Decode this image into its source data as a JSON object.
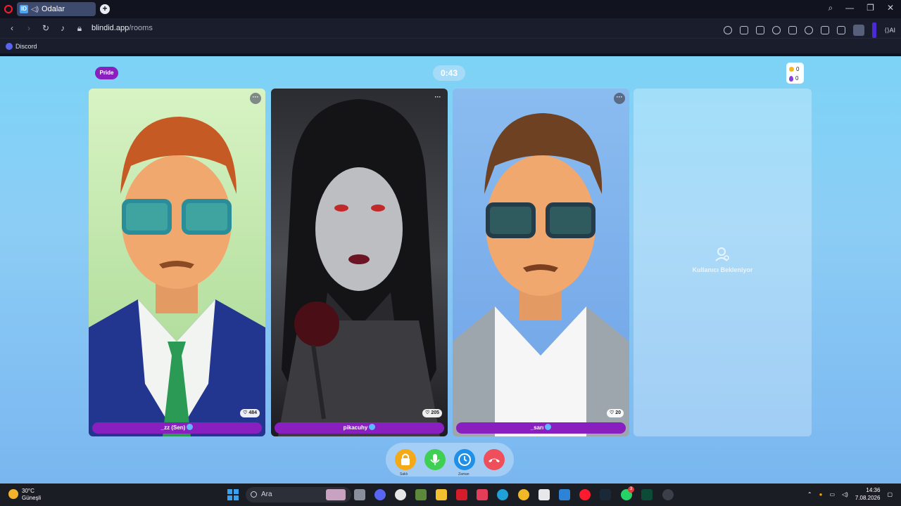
{
  "browser": {
    "tab_title": "Odalar",
    "url_host": "blindid.app",
    "url_path": "/rooms",
    "bookmark": "Discord",
    "ai_label": "AI"
  },
  "room": {
    "category": "Pride",
    "timer": "0:43",
    "coins": "0",
    "gems": "0"
  },
  "participants": [
    {
      "name": "_zz (Sen)",
      "likes": "484"
    },
    {
      "name": "pikacuhy",
      "likes": "205"
    },
    {
      "name": "_sarı",
      "likes": "20"
    }
  ],
  "empty_slot": {
    "label": "Kullanıcı Bekleniyor"
  },
  "controls": {
    "lock_label": "Saklı",
    "clock_label": "Zaman"
  },
  "taskbar": {
    "temperature": "30°C",
    "weather": "Güneşli",
    "search_placeholder": "Ara",
    "time": "14:36",
    "date": "7.08.2026",
    "whatsapp_badge": "3"
  },
  "colors": {
    "accent_purple": "#8a1fbf",
    "lock": "#f4a916",
    "mic": "#3fcf52",
    "clock": "#1f8fe8",
    "hangup": "#ee4f5a"
  }
}
